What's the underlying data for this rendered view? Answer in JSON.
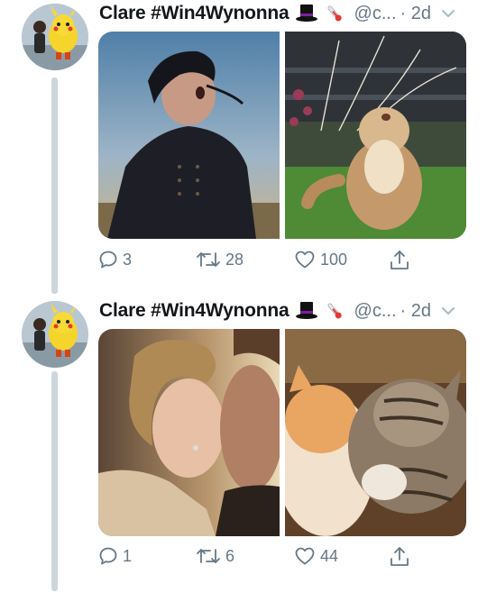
{
  "tweets": [
    {
      "name": "Clare #Win4Wynonna",
      "handle": "@c...",
      "time": "· 2d",
      "reply_count": "3",
      "retweet_count": "28",
      "like_count": "100",
      "images": [
        "person-in-dark-coat-shouting",
        "fluffy-cat-looking-up"
      ]
    },
    {
      "name": "Clare #Win4Wynonna",
      "handle": "@c...",
      "time": "· 2d",
      "reply_count": "1",
      "retweet_count": "6",
      "like_count": "44",
      "images": [
        "two-women-kissing",
        "two-kittens-nuzzling"
      ]
    }
  ],
  "icons": [
    "top-hat-icon",
    "thermometer-icon",
    "chevron-down-icon",
    "reply-icon",
    "retweet-icon",
    "like-icon",
    "share-icon"
  ],
  "colors": {
    "muted": "#657786",
    "thread": "#cdd6dd"
  }
}
